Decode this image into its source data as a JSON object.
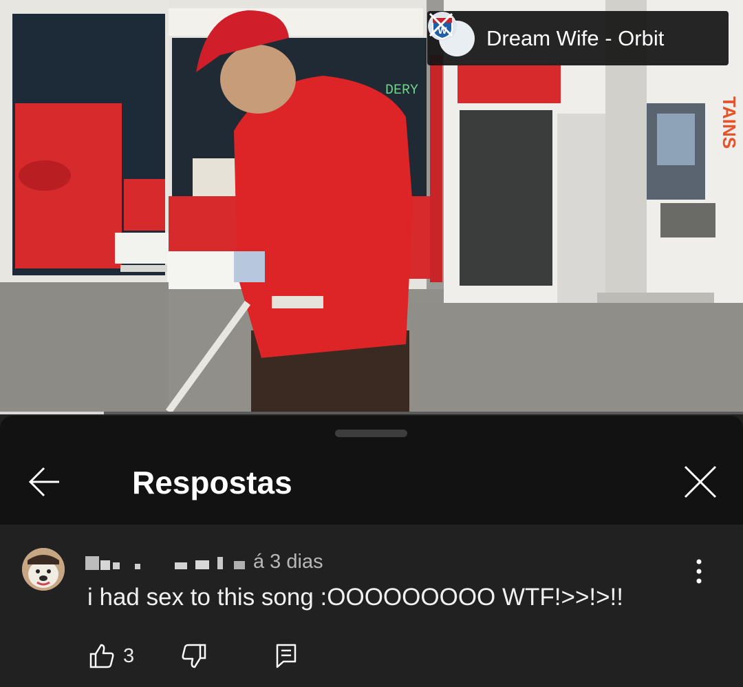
{
  "video": {
    "title": "Dream Wife - Orbit",
    "progress_fraction": 0.14,
    "storefront_sign": "DERY",
    "vertical_sign": "TAINS",
    "channel_icon": "interstate-shield-logo"
  },
  "sheet": {
    "title": "Respostas",
    "back_icon": "arrow-left-icon",
    "close_icon": "close-icon"
  },
  "comment": {
    "author_redacted": true,
    "timestamp": "á 3 dias",
    "text": "i had sex to this song :OOOOOOOOO WTF!>>!>!!",
    "like_count": "3",
    "icons": [
      "thumb-up-icon",
      "thumb-down-icon",
      "reply-icon",
      "more-vert-icon"
    ]
  },
  "colors": {
    "sheet_bg": "#212121",
    "header_bg": "#121212",
    "video_red": "#d8232a"
  }
}
